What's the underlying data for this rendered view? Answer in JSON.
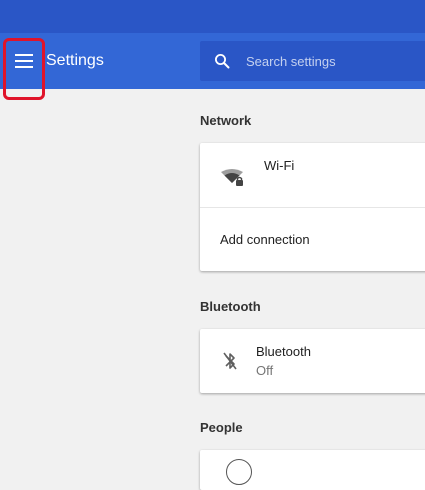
{
  "app": {
    "title": "Settings"
  },
  "search": {
    "placeholder": "Search settings"
  },
  "sections": {
    "network": {
      "title": "Network",
      "wifi": {
        "label": "Wi-Fi"
      },
      "add_connection": {
        "label": "Add connection"
      }
    },
    "bluetooth": {
      "title": "Bluetooth",
      "device": {
        "label": "Bluetooth",
        "status": "Off"
      }
    },
    "people": {
      "title": "People"
    }
  },
  "icons": {
    "menu": "hamburger-menu-icon",
    "search": "magnifier-icon",
    "wifi": "wifi-locked-icon",
    "bluetooth": "bluetooth-disabled-icon"
  },
  "colors": {
    "top_strip": "#2a56c6",
    "app_bar": "#3367d6",
    "search_bg": "#2a56c6",
    "page_bg": "#f1f1f1",
    "annotation": "#e0142a"
  }
}
